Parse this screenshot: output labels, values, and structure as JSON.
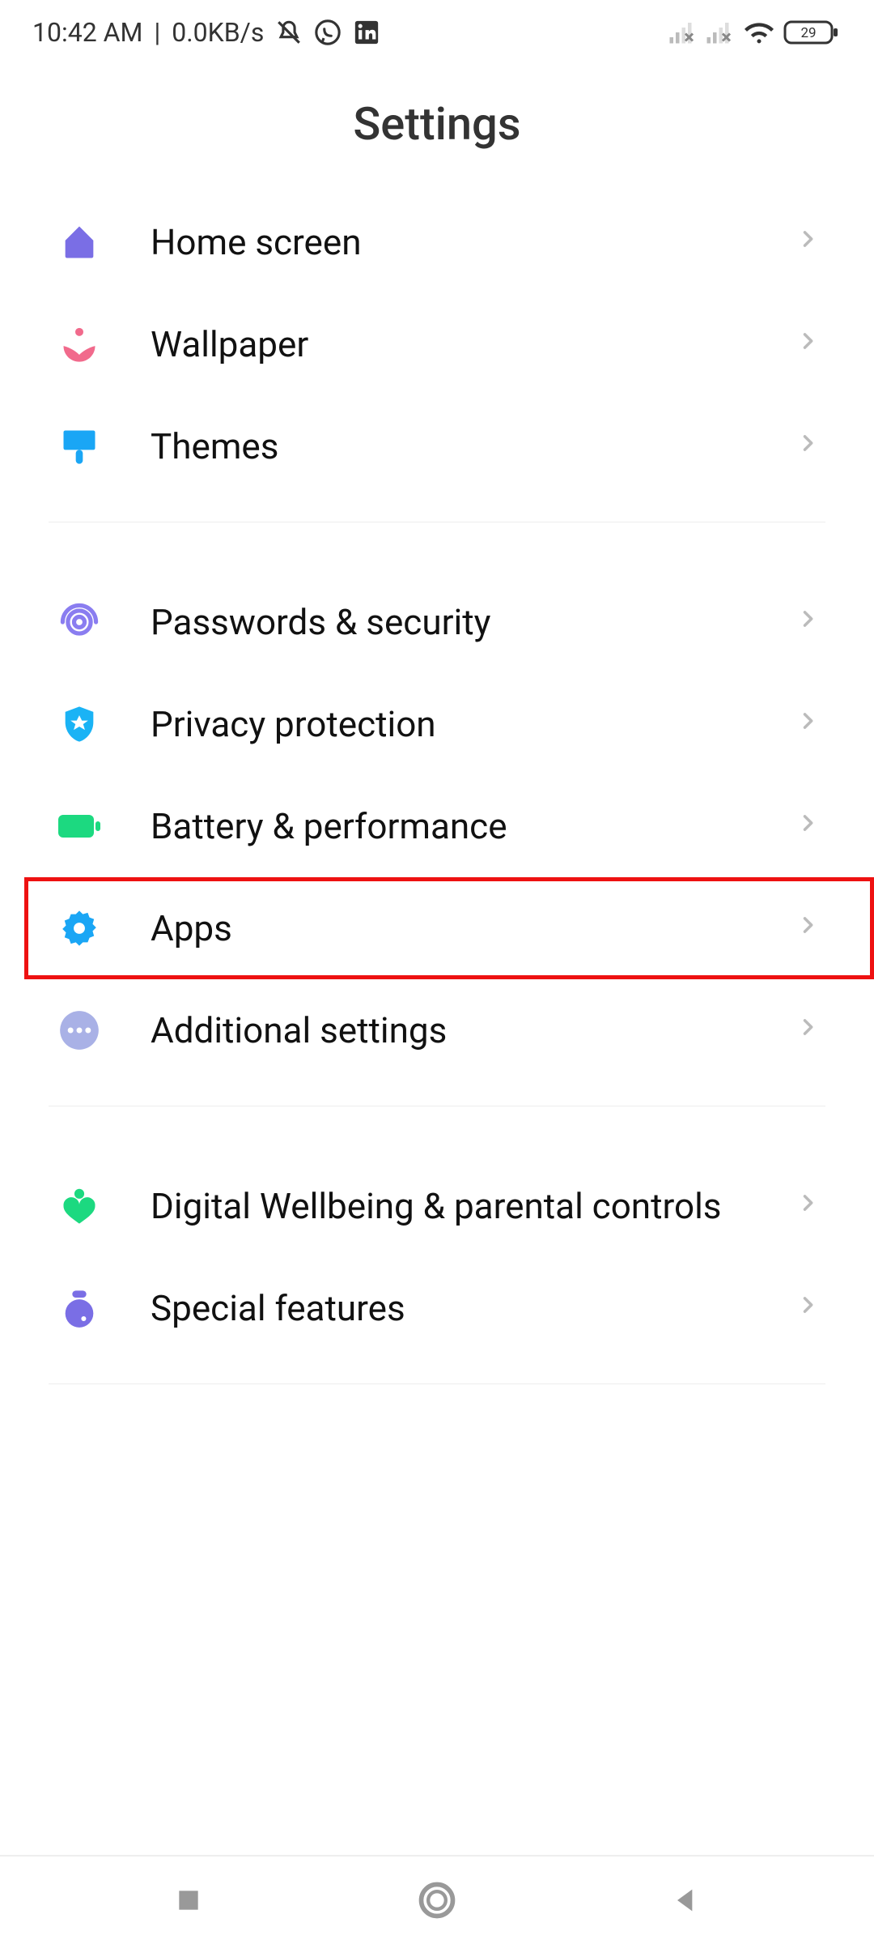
{
  "status_bar": {
    "time": "10:42 AM",
    "separator": "|",
    "data_rate": "0.0KB/s",
    "battery_text": "29"
  },
  "header": {
    "title": "Settings"
  },
  "groups": [
    {
      "items": [
        {
          "key": "home_screen",
          "label": "Home screen",
          "icon_color": "#7a6ee5"
        },
        {
          "key": "wallpaper",
          "label": "Wallpaper",
          "icon_color": "#f16a8c"
        },
        {
          "key": "themes",
          "label": "Themes",
          "icon_color": "#1aa6f5"
        }
      ]
    },
    {
      "items": [
        {
          "key": "passwords_security",
          "label": "Passwords & security",
          "icon_color": "#8a7df0"
        },
        {
          "key": "privacy_protection",
          "label": "Privacy protection",
          "icon_color": "#1ab3f5"
        },
        {
          "key": "battery_performance",
          "label": "Battery & performance",
          "icon_color": "#1cd980"
        },
        {
          "key": "apps",
          "label": "Apps",
          "icon_color": "#1aa6f5",
          "highlight": true
        },
        {
          "key": "additional_settings",
          "label": "Additional settings",
          "icon_color": "#a9b1e6"
        }
      ]
    },
    {
      "items": [
        {
          "key": "digital_wellbeing",
          "label": "Digital Wellbeing & parental controls",
          "icon_color": "#1cd980"
        },
        {
          "key": "special_features",
          "label": "Special features",
          "icon_color": "#7a6ee5"
        }
      ]
    }
  ]
}
